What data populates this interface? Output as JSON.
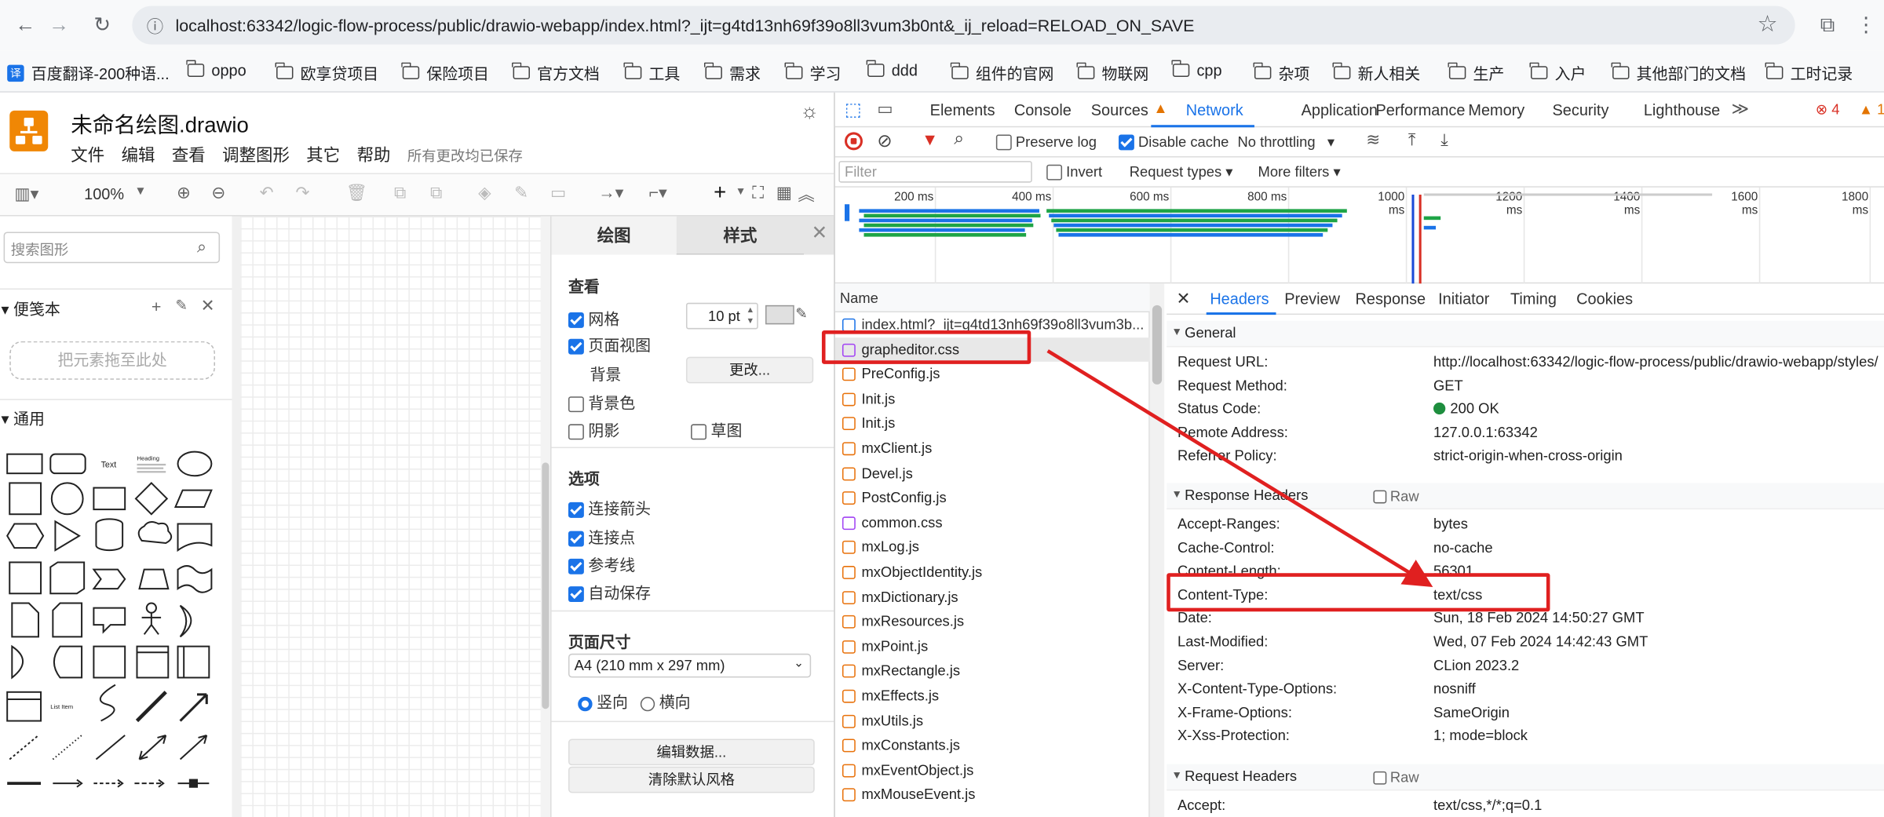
{
  "browser": {
    "url": "localhost:63342/logic-flow-process/public/drawio-webapp/index.html?_ijt=g4td13nh69f39o8ll3vum3b0nt&_ij_reload=RELOAD_ON_SAVE",
    "bookmarks": [
      "百度翻译-200种语...",
      "oppo",
      "欧享贷项目",
      "保险项目",
      "官方文档",
      "工具",
      "需求",
      "学习",
      "ddd",
      "组件的官网",
      "物联网",
      "cpp",
      "杂项",
      "新人相关",
      "生产",
      "入户",
      "其他部门的文档",
      "工时记录"
    ]
  },
  "drawio": {
    "title": "未命名绘图.drawio",
    "menu": [
      "文件",
      "编辑",
      "查看",
      "调整图形",
      "其它",
      "帮助"
    ],
    "save_status": "所有更改均已保存",
    "zoom": "100%",
    "search_placeholder": "搜索图形",
    "scratchpad_title": "便笺本",
    "scratchpad_drop": "把元素拖至此处",
    "general_title": "通用",
    "shape_text": "Text",
    "shape_heading": "Heading",
    "shape_list_item": "List Item",
    "format": {
      "tab_diagram": "绘图",
      "tab_style": "样式",
      "view_heading": "查看",
      "grid_label": "网格",
      "grid_size": "10 pt",
      "page_view_label": "页面视图",
      "background_label": "背景",
      "change_button": "更改...",
      "bg_color_label": "背景色",
      "shadow_label": "阴影",
      "sketch_label": "草图",
      "options_heading": "选项",
      "connection_arrows": "连接箭头",
      "connection_points": "连接点",
      "guides": "参考线",
      "autosave": "自动保存",
      "page_size_heading": "页面尺寸",
      "page_size_value": "A4 (210 mm x 297 mm)",
      "portrait": "竖向",
      "landscape": "横向",
      "edit_data": "编辑数据...",
      "clear_style": "清除默认风格"
    }
  },
  "devtools": {
    "tabs": [
      "Elements",
      "Console",
      "Sources",
      "Network",
      "Application",
      "Performance",
      "Memory",
      "Security",
      "Lighthouse"
    ],
    "active_tab": "Network",
    "error_count": "4",
    "warn_count": "1",
    "preserve_log": "Preserve log",
    "disable_cache": "Disable cache",
    "throttling": "No throttling",
    "filter_placeholder": "Filter",
    "invert": "Invert",
    "request_types": "Request types",
    "more_filters": "More filters",
    "timeline_ticks": [
      "200 ms",
      "400 ms",
      "600 ms",
      "800 ms",
      "1000 ms",
      "1200 ms",
      "1400 ms",
      "1600 ms",
      "1800 ms"
    ],
    "name_header": "Name",
    "files": [
      {
        "name": "index.html?_ijt=g4td13nh69f39o8ll3vum3b...",
        "type": "doc"
      },
      {
        "name": "grapheditor.css",
        "type": "css"
      },
      {
        "name": "PreConfig.js",
        "type": "js"
      },
      {
        "name": "Init.js",
        "type": "js"
      },
      {
        "name": "Init.js",
        "type": "js"
      },
      {
        "name": "mxClient.js",
        "type": "js"
      },
      {
        "name": "Devel.js",
        "type": "js"
      },
      {
        "name": "PostConfig.js",
        "type": "js"
      },
      {
        "name": "common.css",
        "type": "css"
      },
      {
        "name": "mxLog.js",
        "type": "js"
      },
      {
        "name": "mxObjectIdentity.js",
        "type": "js"
      },
      {
        "name": "mxDictionary.js",
        "type": "js"
      },
      {
        "name": "mxResources.js",
        "type": "js"
      },
      {
        "name": "mxPoint.js",
        "type": "js"
      },
      {
        "name": "mxRectangle.js",
        "type": "js"
      },
      {
        "name": "mxEffects.js",
        "type": "js"
      },
      {
        "name": "mxUtils.js",
        "type": "js"
      },
      {
        "name": "mxConstants.js",
        "type": "js"
      },
      {
        "name": "mxEventObject.js",
        "type": "js"
      },
      {
        "name": "mxMouseEvent.js",
        "type": "js"
      }
    ],
    "detail_tabs": [
      "Headers",
      "Preview",
      "Response",
      "Initiator",
      "Timing",
      "Cookies"
    ],
    "general_title": "General",
    "general": [
      {
        "k": "Request URL:",
        "v": "http://localhost:63342/logic-flow-process/public/drawio-webapp/styles/"
      },
      {
        "k": "Request Method:",
        "v": "GET"
      },
      {
        "k": "Status Code:",
        "v": "200 OK"
      },
      {
        "k": "Remote Address:",
        "v": "127.0.0.1:63342"
      },
      {
        "k": "Referrer Policy:",
        "v": "strict-origin-when-cross-origin"
      }
    ],
    "response_headers_title": "Response Headers",
    "raw": "Raw",
    "response_headers": [
      {
        "k": "Accept-Ranges:",
        "v": "bytes"
      },
      {
        "k": "Cache-Control:",
        "v": "no-cache"
      },
      {
        "k": "Content-Length:",
        "v": "56301"
      },
      {
        "k": "Content-Type:",
        "v": "text/css"
      },
      {
        "k": "Date:",
        "v": "Sun, 18 Feb 2024 14:50:27 GMT"
      },
      {
        "k": "Last-Modified:",
        "v": "Wed, 07 Feb 2024 14:42:43 GMT"
      },
      {
        "k": "Server:",
        "v": "CLion 2023.2"
      },
      {
        "k": "X-Content-Type-Options:",
        "v": "nosniff"
      },
      {
        "k": "X-Frame-Options:",
        "v": "SameOrigin"
      },
      {
        "k": "X-Xss-Protection:",
        "v": "1; mode=block"
      }
    ],
    "request_headers_title": "Request Headers",
    "request_headers": [
      {
        "k": "Accept:",
        "v": "text/css,*/*;q=0.1"
      }
    ]
  },
  "colors": {
    "drawio_orange": "#f08705",
    "annotation_red": "#e02020",
    "devtools_blue": "#1a73e8"
  }
}
